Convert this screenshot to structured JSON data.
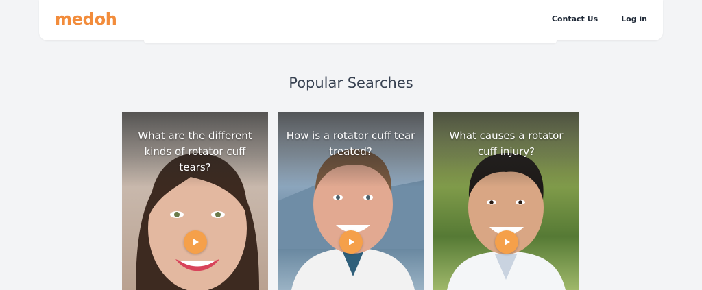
{
  "brand": {
    "name": "medoh",
    "color": "#f28c3b"
  },
  "nav": {
    "contact_label": "Contact Us",
    "login_label": "Log in"
  },
  "section": {
    "title": "Popular Searches"
  },
  "cards": [
    {
      "title": "What are the different kinds of rotator cuff tears?",
      "icon": "play-icon"
    },
    {
      "title": "How is a rotator cuff tear treated?",
      "icon": "play-icon"
    },
    {
      "title": "What causes a rotator cuff injury?",
      "icon": "play-icon"
    }
  ],
  "colors": {
    "accent": "#f5a04a",
    "background": "#f3f4f6",
    "text": "#374151"
  }
}
